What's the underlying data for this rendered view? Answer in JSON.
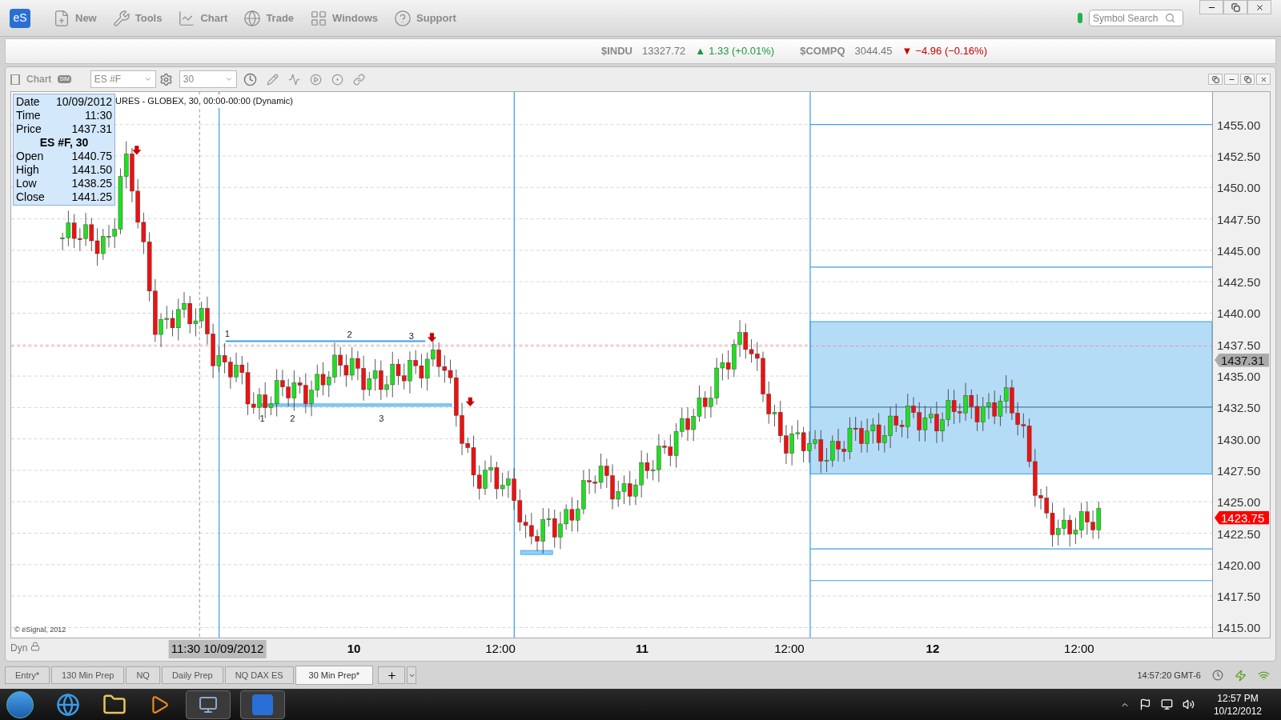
{
  "toolbar": {
    "items": [
      {
        "label": "New",
        "kind": "new"
      },
      {
        "label": "Tools",
        "kind": "tools"
      },
      {
        "label": "Chart",
        "kind": "chart"
      },
      {
        "label": "Trade",
        "kind": "trade"
      },
      {
        "label": "Windows",
        "kind": "windows"
      },
      {
        "label": "Support",
        "kind": "support"
      }
    ],
    "logo": "eS",
    "search": {
      "placeholder": "Symbol Search"
    }
  },
  "tickers": [
    {
      "symbol": "$INDU",
      "price": "13327.72",
      "change": "1.33 (+0.01%)",
      "arrow": "▲",
      "color": "#179c36"
    },
    {
      "symbol": "$COMPQ",
      "price": "3044.45",
      "change": "−4.96 (−0.16%)",
      "arrow": "▼",
      "color": "#c40000"
    }
  ],
  "chart": {
    "title": "Chart",
    "sim": "SIM",
    "symbol": "ES #F",
    "interval": "30",
    "study_title": "URES - GLOBEX, 30, 00:00-00:00 (Dynamic)",
    "info_top": [
      {
        "label": "Date",
        "value": "10/09/2012"
      },
      {
        "label": "Time",
        "value": "11:30"
      },
      {
        "label": "Price",
        "value": "1437.31"
      }
    ],
    "info_header": "ES #F, 30",
    "info_bottom": [
      {
        "label": "Open",
        "value": "1440.75"
      },
      {
        "label": "High",
        "value": "1441.50"
      },
      {
        "label": "Low",
        "value": "1438.25"
      },
      {
        "label": "Close",
        "value": "1441.25"
      }
    ],
    "price_ticks": [
      "1455.00",
      "1452.50",
      "1450.00",
      "1447.50",
      "1445.00",
      "1442.50",
      "1440.00",
      "1437.50",
      "1435.00",
      "1432.50",
      "1430.00",
      "1427.50",
      "1425.00",
      "1422.50",
      "1420.00",
      "1417.50",
      "1415.00"
    ],
    "price_flags": [
      {
        "text": "1437.31",
        "kind": "cursor"
      },
      {
        "text": "1423.75",
        "kind": "last"
      }
    ],
    "annotations": [
      "1",
      "2",
      "3",
      "1",
      "2",
      "3"
    ],
    "copyright": "© eSignal, 2012",
    "dyn": "Dyn",
    "cursor_time": "11:30 10/09/2012",
    "time_labels": [
      {
        "text": "10",
        "bold": true
      },
      {
        "text": "12:00",
        "bold": false
      },
      {
        "text": "11",
        "bold": true
      },
      {
        "text": "12:00",
        "bold": false
      },
      {
        "text": "12",
        "bold": true
      },
      {
        "text": "12:00",
        "bold": false
      }
    ]
  },
  "tabs": [
    {
      "label": "Entry*",
      "selected": false
    },
    {
      "label": "130 Min Prep",
      "selected": false
    },
    {
      "label": "NQ",
      "selected": false
    },
    {
      "label": "Daily Prep",
      "selected": false
    },
    {
      "label": "NQ DAX ES",
      "selected": false
    },
    {
      "label": "30 Min Prep*",
      "selected": true
    }
  ],
  "status_time": "14:57:20 GMT-6",
  "taskbar": {
    "time": "12:57 PM",
    "date": "10/12/2012"
  }
}
